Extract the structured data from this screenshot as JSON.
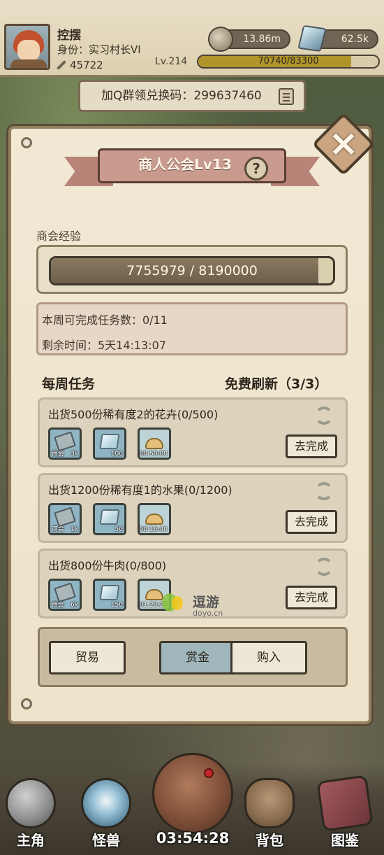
{
  "player": {
    "name": "控摆",
    "title": "身份：实习村长VI",
    "power": "45722",
    "coins": "13.86m",
    "gems": "62.5k",
    "level": "Lv.214",
    "xp_text": "70740/83300",
    "xp_progress": 0.849
  },
  "code_bar": {
    "text": "加Q群领兑换码：299637460"
  },
  "guild": {
    "title": "商人公会Lv13",
    "help": "?",
    "exp_label": "商会经验",
    "exp_text": "7755979 / 8190000",
    "exp_progress": 0.947,
    "weekly_count": "本周可完成任务数：0/11",
    "remaining_time": "剩余时间：5天14:13:07",
    "weekly_tasks_label": "每周任务",
    "free_refresh": "免费刷新（3/3）",
    "close_icon": "×"
  },
  "tasks": [
    {
      "title": "出货500份稀有度2的花卉(0/500)",
      "rewards": [
        {
          "icon": "guild-ticket",
          "amount": "3k"
        },
        {
          "icon": "crystal",
          "amount": "100"
        },
        {
          "icon": "sand-pile",
          "amount": "00:50:00"
        }
      ],
      "button": "去完成"
    },
    {
      "title": "出货1200份稀有度1的水果(0/1200)",
      "rewards": [
        {
          "icon": "guild-ticket",
          "amount": "1k"
        },
        {
          "icon": "crystal",
          "amount": "50"
        },
        {
          "icon": "sand-pile",
          "amount": "00:16:40"
        }
      ],
      "button": "去完成"
    },
    {
      "title": "出货800份牛肉(0/800)",
      "rewards": [
        {
          "icon": "guild-ticket",
          "amount": "6k"
        },
        {
          "icon": "crystal",
          "amount": "150"
        },
        {
          "icon": "sand-pile",
          "amount": "01:23:20"
        }
      ],
      "button": "去完成"
    }
  ],
  "reward_ticket_text": "商会",
  "tabs": [
    {
      "label": "贸易",
      "active": false
    },
    {
      "label": "赏金",
      "active": true
    },
    {
      "label": "购入",
      "active": false
    }
  ],
  "watermark": {
    "name": "逗游",
    "site": "doyo.cn"
  },
  "nav": {
    "hero": "主角",
    "monster": "怪兽",
    "bag": "背包",
    "codex": "图鉴",
    "timer": "03:54:28"
  },
  "colors": {
    "panel_bg": "#f1e9d4",
    "ribbon": "#c99a8e",
    "active_tab": "#9fb7bb",
    "xp_fill": "#b0952b"
  }
}
